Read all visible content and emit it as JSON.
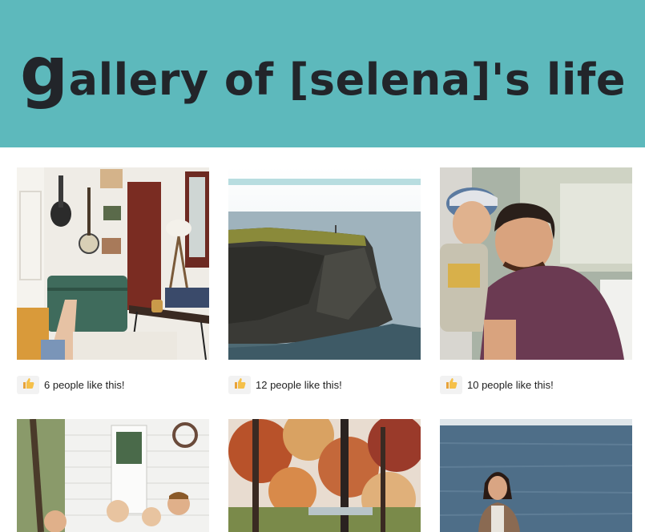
{
  "header": {
    "title_first_letter": "g",
    "title_rest": "allery of [selena]'s life",
    "background": "#5db9bc"
  },
  "photos": [
    {
      "subject": "living room with guitar and banjo on wall, feet up",
      "icon": "thumbs-up-icon",
      "likes_text": "6 people like this!"
    },
    {
      "subject": "sea cliff with a person on top",
      "icon": "thumbs-up-icon",
      "likes_text": "12 people like this!"
    },
    {
      "subject": "laughing young man in maroon t-shirt",
      "icon": "thumbs-up-icon",
      "likes_text": "10 people like this!"
    },
    {
      "subject": "children outside a white shed",
      "icon": "thumbs-up-icon",
      "likes_text": ""
    },
    {
      "subject": "autumn trees",
      "icon": "thumbs-up-icon",
      "likes_text": ""
    },
    {
      "subject": "woman standing in the sea",
      "icon": "thumbs-up-icon",
      "likes_text": ""
    }
  ]
}
